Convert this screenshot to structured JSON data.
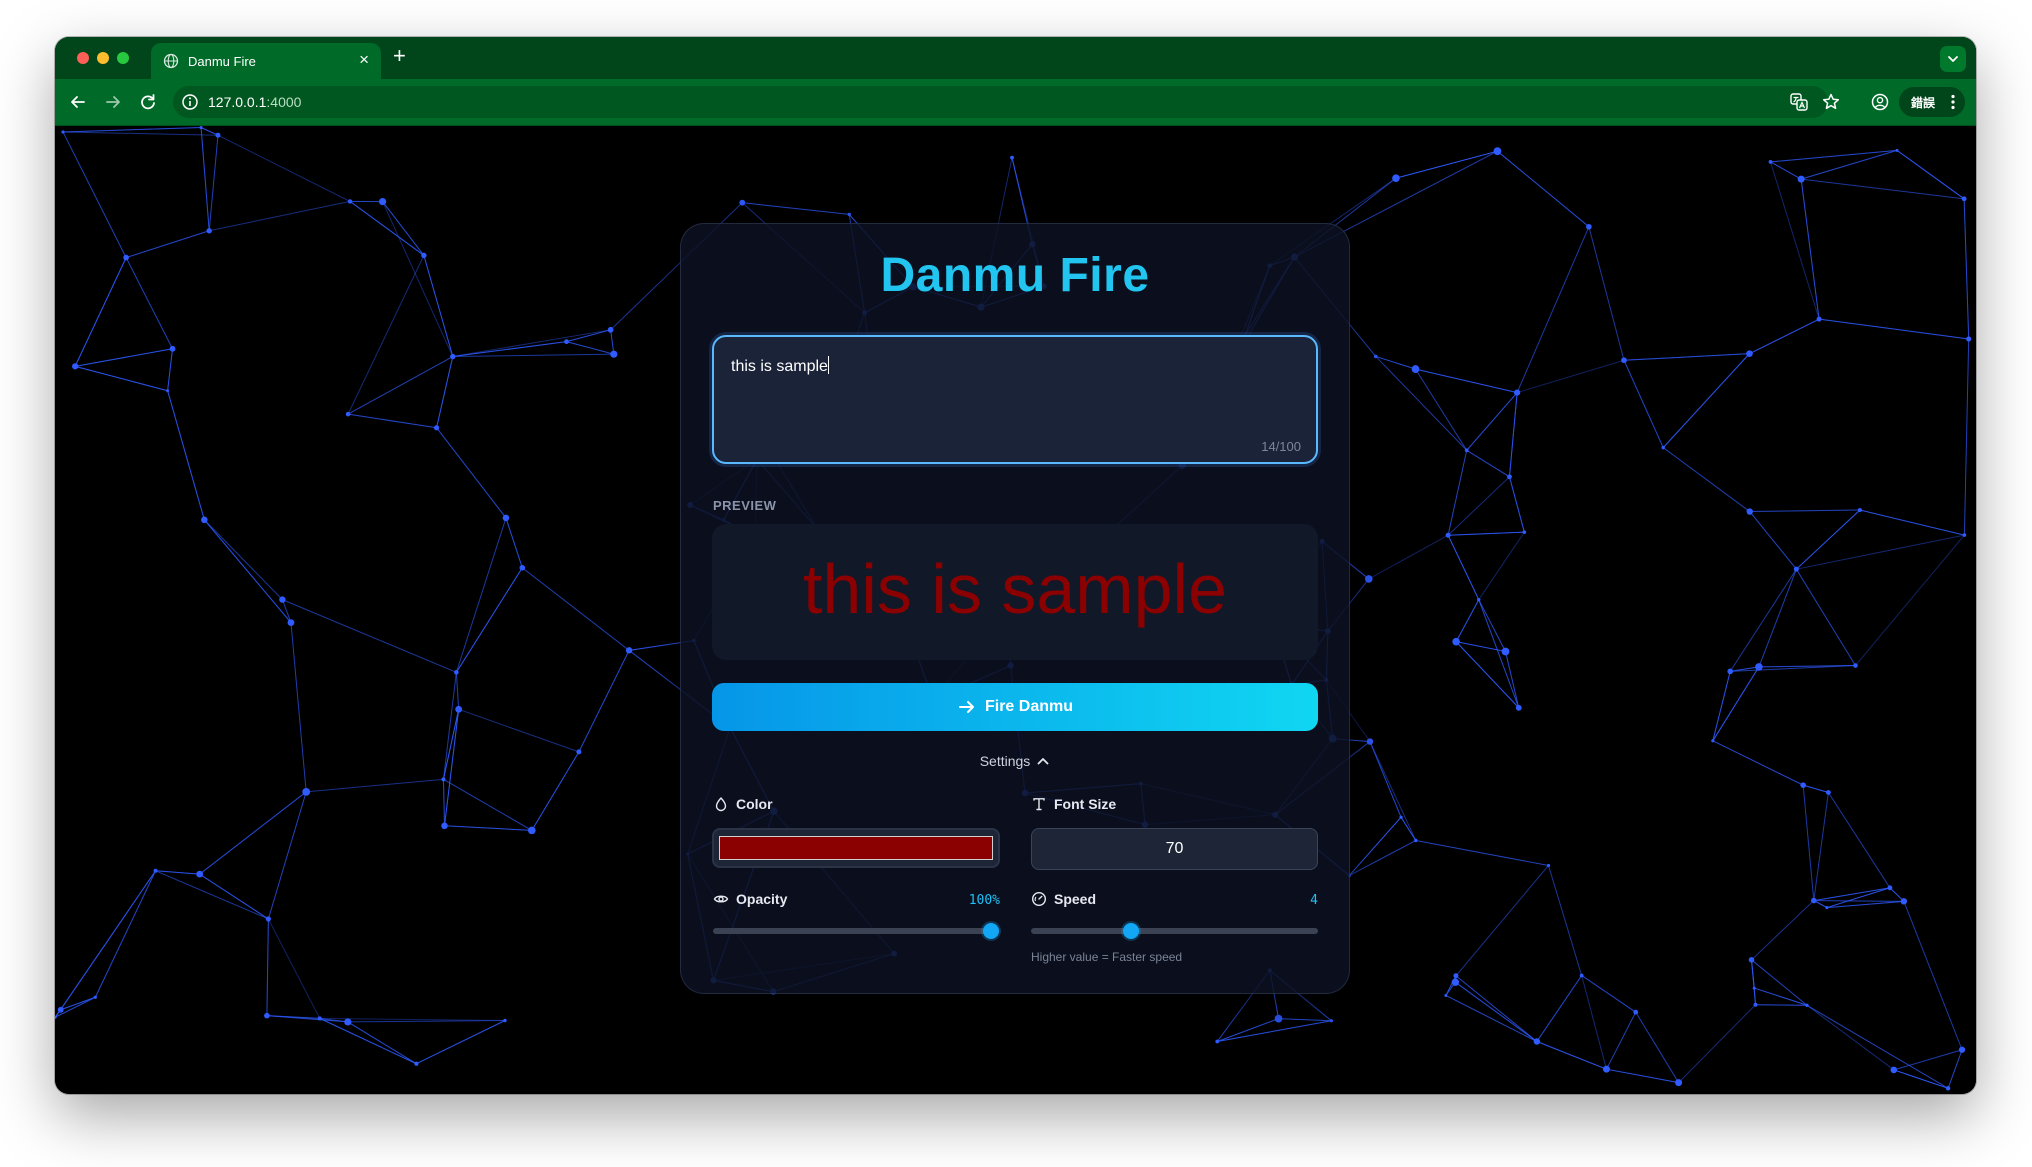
{
  "browser": {
    "tab_title": "Danmu Fire",
    "tab_close": "×",
    "new_tab": "+",
    "url_host": "127.0.0.1",
    "url_port": ":4000",
    "profile_label": "錯誤"
  },
  "app": {
    "title": "Danmu Fire",
    "message": {
      "value": "this is sample",
      "count": "14/100"
    },
    "preview": {
      "label": "PREVIEW",
      "text": "this is sample",
      "color": "#8b0000"
    },
    "fire_button": "Fire Danmu",
    "settings_toggle": "Settings",
    "settings": {
      "color_label": "Color",
      "color_value": "#8b0000",
      "font_size_label": "Font Size",
      "font_size_value": "70",
      "opacity_label": "Opacity",
      "opacity_display": "100%",
      "opacity_fraction": 1.0,
      "speed_label": "Speed",
      "speed_display": "4",
      "speed_fraction": 0.34,
      "speed_hint": "Higher value = Faster speed"
    }
  },
  "colors": {
    "accent": "#22c5f0",
    "button_start": "#0696e8",
    "button_end": "#10d6f2",
    "network_line": "#2f5bff",
    "chrome_green": "#006a28"
  },
  "icons": [
    "globe-icon",
    "back-arrow-icon",
    "forward-arrow-icon",
    "reload-icon",
    "site-info-icon",
    "translate-icon",
    "bookmark-star-icon",
    "account-icon",
    "more-menu-icon",
    "arrow-right-icon",
    "chevron-up-icon",
    "droplet-icon",
    "type-icon",
    "eye-icon",
    "gauge-icon"
  ]
}
